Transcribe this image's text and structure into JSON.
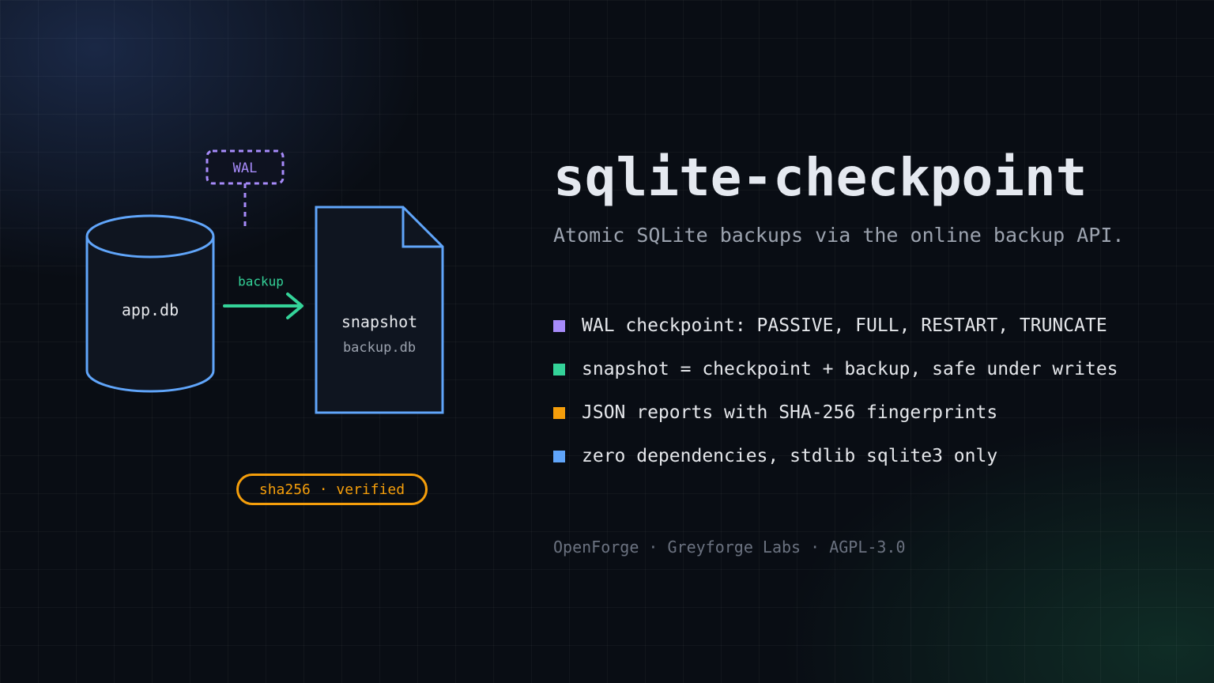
{
  "diagram": {
    "wal_label": "WAL",
    "backup_label": "backup",
    "source_db": "app.db",
    "snapshot_title": "snapshot",
    "snapshot_file": "backup.db",
    "badge": "sha256 · verified",
    "colors": {
      "database_stroke": "#60a5fa",
      "wal_stroke": "#a78bfa",
      "arrow": "#34d399",
      "badge": "#f59e0b"
    }
  },
  "header": {
    "title": "sqlite-checkpoint",
    "subtitle": "Atomic SQLite backups via the online backup API."
  },
  "features": [
    {
      "text": "WAL checkpoint: PASSIVE, FULL, RESTART, TRUNCATE",
      "color": "#a78bfa"
    },
    {
      "text": "snapshot = checkpoint + backup, safe under writes",
      "color": "#34d399"
    },
    {
      "text": "JSON reports with SHA-256 fingerprints",
      "color": "#f59e0b"
    },
    {
      "text": "zero dependencies, stdlib sqlite3 only",
      "color": "#60a5fa"
    }
  ],
  "footer": "OpenForge · Greyforge Labs · AGPL-3.0"
}
